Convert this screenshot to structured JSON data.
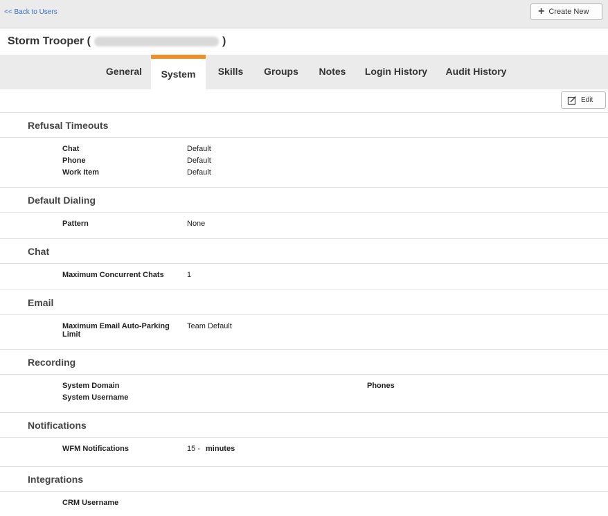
{
  "topbar": {
    "back_label": "<< Back to Users",
    "create_label": "Create New"
  },
  "header": {
    "user_name": "Storm Trooper (",
    "close_paren": ")"
  },
  "tabs": [
    {
      "label": "General"
    },
    {
      "label": "System"
    },
    {
      "label": "Skills"
    },
    {
      "label": "Groups"
    },
    {
      "label": "Notes"
    },
    {
      "label": "Login History"
    },
    {
      "label": "Audit History"
    }
  ],
  "active_tab": "System",
  "toolbar": {
    "edit_label": "Edit"
  },
  "sections": {
    "refusal": {
      "title": "Refusal Timeouts",
      "rows": [
        {
          "label": "Chat",
          "value": "Default"
        },
        {
          "label": "Phone",
          "value": "Default"
        },
        {
          "label": "Work Item",
          "value": "Default"
        }
      ]
    },
    "dialing": {
      "title": "Default Dialing",
      "rows": [
        {
          "label": "Pattern",
          "value": "None"
        }
      ]
    },
    "chat": {
      "title": "Chat",
      "rows": [
        {
          "label": "Maximum Concurrent Chats",
          "value": "1"
        }
      ]
    },
    "email": {
      "title": "Email",
      "rows": [
        {
          "label": "Maximum Email Auto-Parking Limit",
          "value": "Team Default"
        }
      ]
    },
    "recording": {
      "title": "Recording",
      "rows": [
        {
          "label": "System Domain",
          "value": ""
        },
        {
          "label": "System Username",
          "value": ""
        }
      ],
      "phones_label": "Phones"
    },
    "notifications": {
      "title": "Notifications",
      "rows": [
        {
          "label": "WFM Notifications",
          "value": "15 -",
          "unit": "minutes"
        }
      ]
    },
    "integrations": {
      "title": "Integrations",
      "rows": [
        {
          "label": "CRM Username",
          "value": ""
        }
      ]
    }
  },
  "colors": {
    "accent_tab": "#f0902a",
    "link": "#3a6fc4",
    "tab_bar_bg": "#ebebeb"
  }
}
